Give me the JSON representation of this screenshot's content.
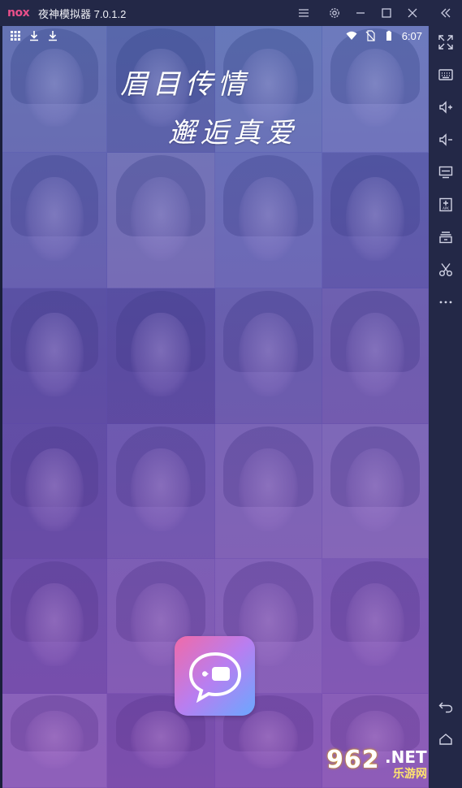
{
  "window": {
    "logo": "nox",
    "title": "夜神模拟器 7.0.1.2"
  },
  "title_controls": [
    {
      "name": "menu-icon"
    },
    {
      "name": "settings-icon"
    },
    {
      "name": "minimize-icon"
    },
    {
      "name": "maximize-icon"
    },
    {
      "name": "close-icon"
    },
    {
      "name": "collapse-sidebar-icon"
    }
  ],
  "statusbar": {
    "time": "6:07",
    "left_icons": [
      "apps-grid-icon",
      "download-icon",
      "download-icon"
    ],
    "right_icons": [
      "wifi-icon",
      "no-sim-icon",
      "battery-icon"
    ]
  },
  "splash": {
    "line1": "眉目传情",
    "line2": "邂逅真爱"
  },
  "sidebar": [
    {
      "name": "fullscreen-icon"
    },
    {
      "name": "keyboard-icon"
    },
    {
      "name": "volume-up-icon"
    },
    {
      "name": "volume-down-icon"
    },
    {
      "name": "screen-icon"
    },
    {
      "name": "install-apk-icon"
    },
    {
      "name": "multi-instance-icon"
    },
    {
      "name": "screenshot-scissors-icon"
    },
    {
      "name": "more-icon"
    },
    {
      "name": "back-icon"
    },
    {
      "name": "home-icon"
    }
  ],
  "watermark": {
    "number": "962",
    "domain": ".NET",
    "sub": "乐游网"
  },
  "colors": {
    "chrome": "#232847",
    "overlay_top": "#466ec8",
    "overlay_bottom": "#8746be",
    "icon_gradient": [
      "#f06aa8",
      "#b87ef0",
      "#6aa8ff"
    ]
  }
}
